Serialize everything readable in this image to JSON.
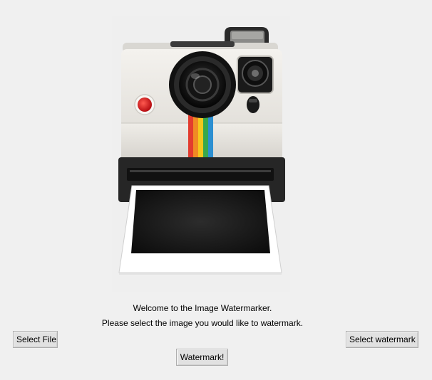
{
  "window": {
    "welcome_text": "Welcome to the Image Watermarker.",
    "instruction_text": "Please select the image you would like to watermark."
  },
  "buttons": {
    "select_file_label": "Select File",
    "select_watermark_label": "Select watermark",
    "watermark_label": "Watermark!"
  },
  "logo": {
    "icon": "instant-camera-icon",
    "stripe_colors": [
      "#e23b2e",
      "#f08a24",
      "#f4c81d",
      "#39a84b",
      "#2c8fd1"
    ],
    "shutter_color": "#d3131b"
  }
}
